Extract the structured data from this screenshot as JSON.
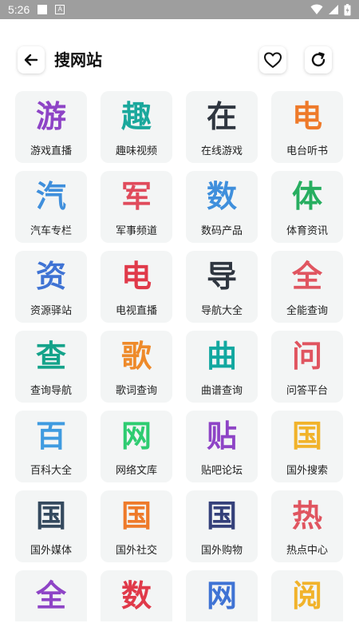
{
  "status_bar": {
    "time": "5:26",
    "a_badge": "A"
  },
  "header": {
    "title": "搜网站"
  },
  "tiles": [
    {
      "char": "游",
      "label": "游戏直播",
      "color": "#8e44c6"
    },
    {
      "char": "趣",
      "label": "趣味视频",
      "color": "#1aa89c"
    },
    {
      "char": "在",
      "label": "在线游戏",
      "color": "#2f3640"
    },
    {
      "char": "电",
      "label": "电台听书",
      "color": "#ee7a2a"
    },
    {
      "char": "汽",
      "label": "汽车专栏",
      "color": "#3f8fdc"
    },
    {
      "char": "军",
      "label": "军事频道",
      "color": "#e04b5c"
    },
    {
      "char": "数",
      "label": "数码产品",
      "color": "#3f8fdc"
    },
    {
      "char": "体",
      "label": "体育资讯",
      "color": "#27ae60"
    },
    {
      "char": "资",
      "label": "资源驿站",
      "color": "#3f73d4"
    },
    {
      "char": "电",
      "label": "电视直播",
      "color": "#e03a4a"
    },
    {
      "char": "导",
      "label": "导航大全",
      "color": "#2f3640"
    },
    {
      "char": "全",
      "label": "全能查询",
      "color": "#e05560"
    },
    {
      "char": "查",
      "label": "查询导航",
      "color": "#14a38a"
    },
    {
      "char": "歌",
      "label": "歌词查询",
      "color": "#ee8a2a"
    },
    {
      "char": "曲",
      "label": "曲谱查询",
      "color": "#12a8a0"
    },
    {
      "char": "问",
      "label": "问答平台",
      "color": "#e05560"
    },
    {
      "char": "百",
      "label": "百科大全",
      "color": "#3f9be0"
    },
    {
      "char": "网",
      "label": "网络文库",
      "color": "#2ecc71"
    },
    {
      "char": "贴",
      "label": "贴吧论坛",
      "color": "#8e44c6"
    },
    {
      "char": "国",
      "label": "国外搜索",
      "color": "#f1b32b"
    },
    {
      "char": "国",
      "label": "国外媒体",
      "color": "#34495e"
    },
    {
      "char": "国",
      "label": "国外社交",
      "color": "#ee7a2a"
    },
    {
      "char": "国",
      "label": "国外购物",
      "color": "#34407a"
    },
    {
      "char": "热",
      "label": "热点中心",
      "color": "#e05560"
    },
    {
      "char": "全",
      "label": "",
      "color": "#8e44c6"
    },
    {
      "char": "数",
      "label": "",
      "color": "#e03a4a"
    },
    {
      "char": "网",
      "label": "",
      "color": "#3f73d4"
    },
    {
      "char": "阅",
      "label": "",
      "color": "#f1b32b"
    }
  ]
}
